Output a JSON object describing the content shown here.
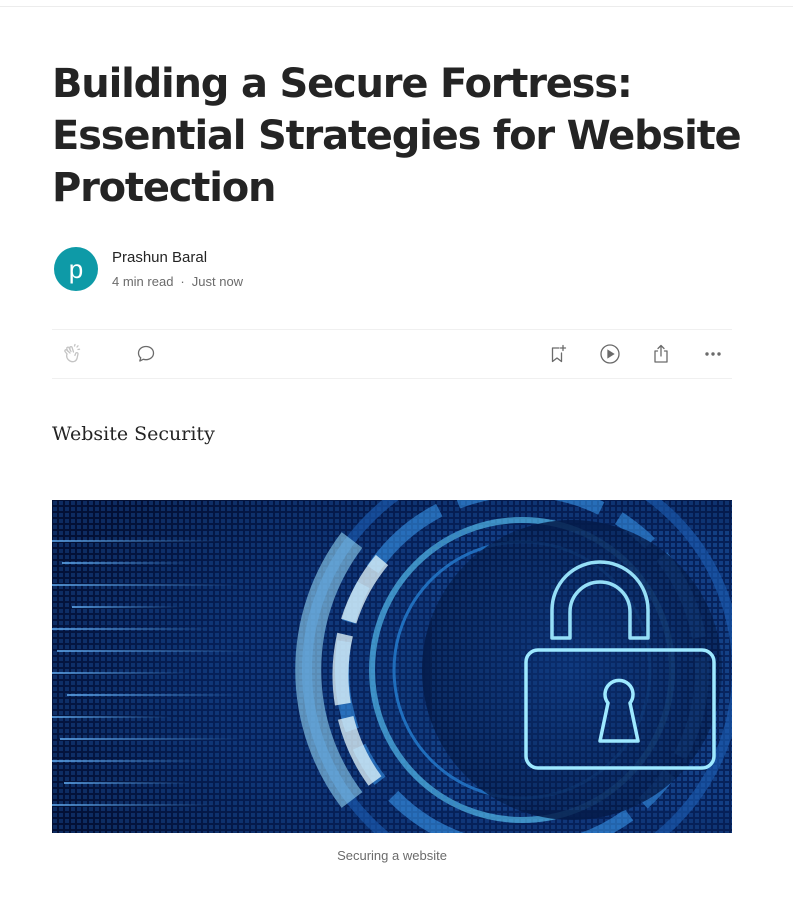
{
  "article": {
    "title": "Building a Secure Fortress: Essential Strategies for Website Protection",
    "subtitle": "Website Security",
    "author": {
      "name": "Prashun Baral",
      "avatar_letter": "p",
      "avatar_color": "#0e9aa7",
      "read_time": "4 min read",
      "separator": "·",
      "published": "Just now"
    },
    "action_bar": {
      "left": [
        "clap-icon",
        "comment-icon"
      ],
      "right": [
        "bookmark-add-icon",
        "play-icon",
        "share-icon",
        "more-icon"
      ]
    },
    "hero_image": {
      "depicts": "padlock-icon",
      "caption": "Securing a website"
    }
  },
  "colors": {
    "text": "#242424",
    "muted": "#6b6b6b",
    "icon": "#6b6b6b",
    "hero_dark": "#041840",
    "hero_glow": "#4fd6ff"
  }
}
